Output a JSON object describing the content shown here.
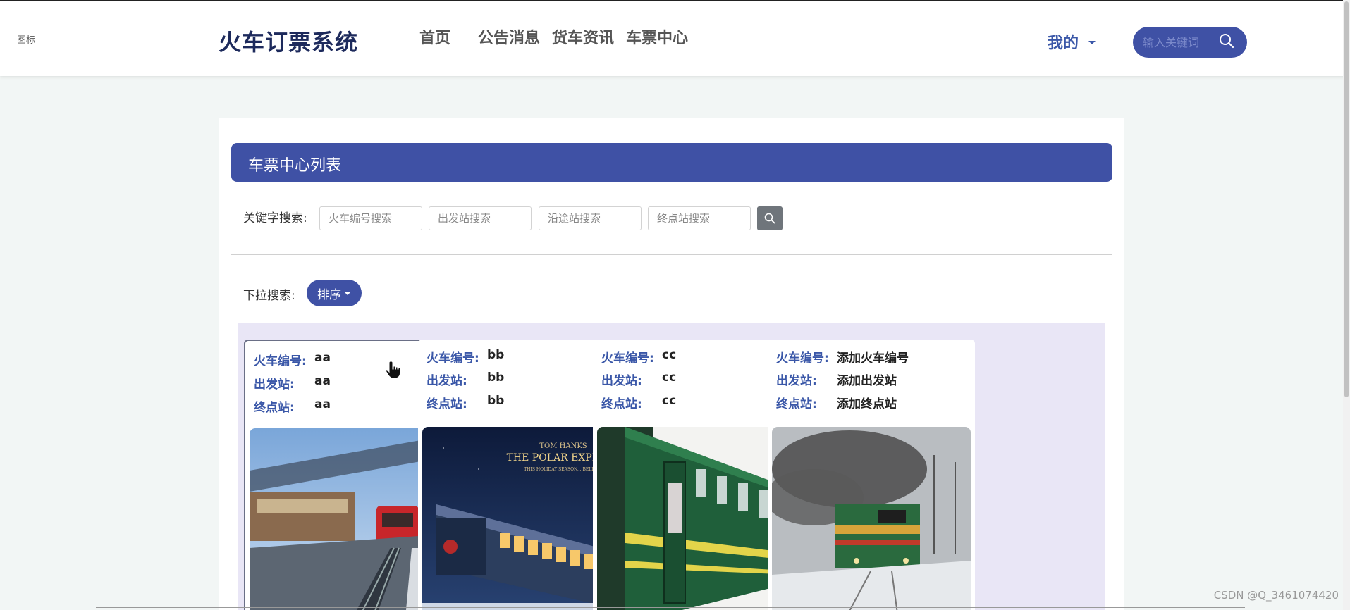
{
  "header": {
    "logo_text": "图标",
    "site_title": "火车订票系统",
    "nav": [
      "首页",
      "公告消息",
      "货车资讯",
      "车票中心"
    ],
    "user_menu": "我的",
    "search_placeholder": "输入关键词"
  },
  "main": {
    "list_title": "车票中心列表",
    "keyword_label": "关键字搜索:",
    "search_fields": [
      {
        "placeholder": "火车编号搜索"
      },
      {
        "placeholder": "出发站搜索"
      },
      {
        "placeholder": "沿途站搜索"
      },
      {
        "placeholder": "终点站搜索"
      }
    ],
    "dropdown_label": "下拉搜索:",
    "sort_label": "排序",
    "field_labels": {
      "train_no": "火车编号:",
      "departure": "出发站:",
      "terminal": "终点站:"
    },
    "cards": [
      {
        "train_no": "aa",
        "departure": "aa",
        "terminal": "aa",
        "image": "train-at-platform"
      },
      {
        "train_no": "bb",
        "departure": "bb",
        "terminal": "bb",
        "image": "polar-express-poster"
      },
      {
        "train_no": "cc",
        "departure": "cc",
        "terminal": "cc",
        "image": "green-passenger-car"
      },
      {
        "train_no": "添加火车编号",
        "departure": "添加出发站",
        "terminal": "添加终点站",
        "image": "diesel-locomotive-snow"
      }
    ],
    "poster_text": {
      "line1": "TOM HANKS",
      "line2": "THE POLAR EXPRESS",
      "line3": "THIS HOLIDAY SEASON... BELIEVE"
    }
  },
  "watermark": "CSDN @Q_3461074420",
  "colors": {
    "accent": "#3f51a5",
    "title_dark": "#1d2a5c",
    "label_blue": "#3a57a8",
    "cards_bg": "#e9e6f6",
    "page_bg": "#f2f6f5"
  }
}
